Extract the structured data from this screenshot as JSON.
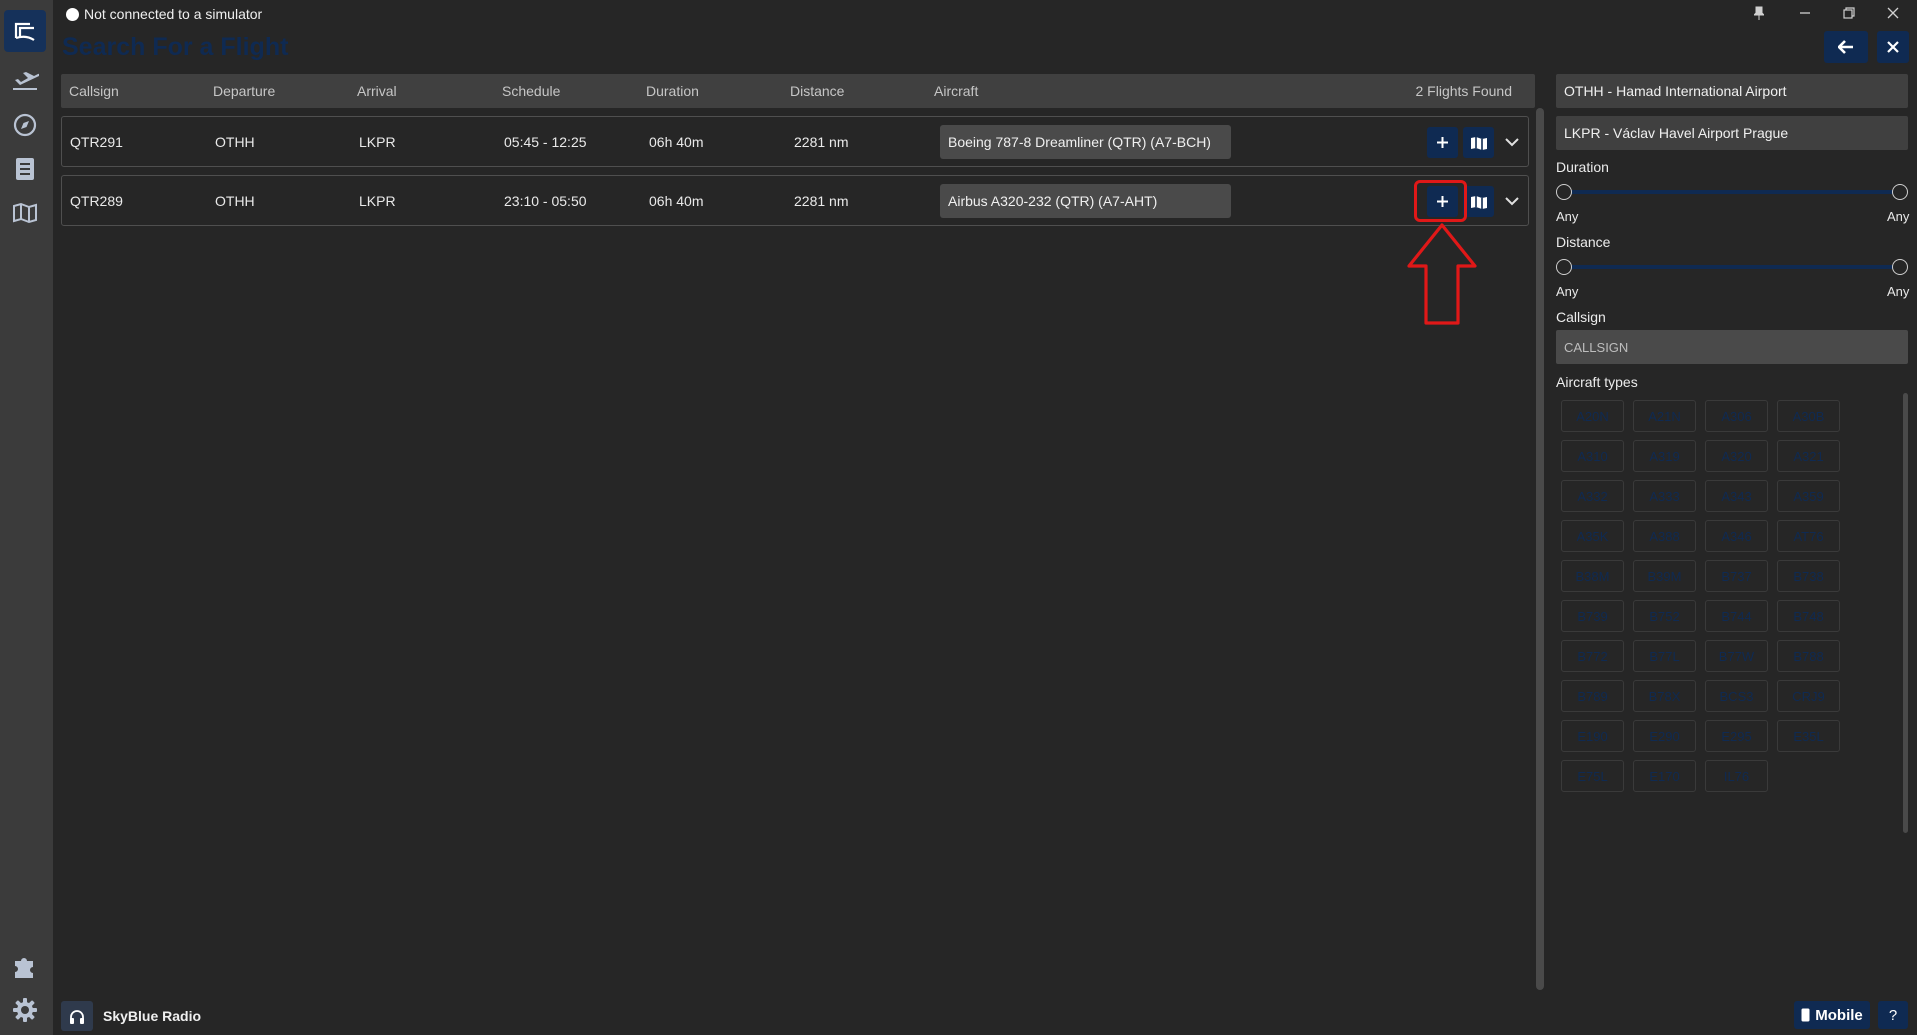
{
  "status": {
    "text": "Not connected to a simulator"
  },
  "page": {
    "title": "Search For a Flight"
  },
  "table": {
    "headers": [
      "Callsign",
      "Departure",
      "Arrival",
      "Schedule",
      "Duration",
      "Distance",
      "Aircraft"
    ],
    "found": "2 Flights Found",
    "rows": [
      {
        "callsign": "QTR291",
        "departure": "OTHH",
        "arrival": "LKPR",
        "schedule": "05:45 - 12:25",
        "duration": "06h 40m",
        "distance": "2281 nm",
        "aircraft": "Boeing 787-8 Dreamliner (QTR) (A7-BCH)"
      },
      {
        "callsign": "QTR289",
        "departure": "OTHH",
        "arrival": "LKPR",
        "schedule": "23:10 - 05:50",
        "duration": "06h 40m",
        "distance": "2281 nm",
        "aircraft": "Airbus A320-232 (QTR) (A7-AHT)"
      }
    ]
  },
  "filters": {
    "departure": "OTHH - Hamad International Airport",
    "arrival": "LKPR - Václav Havel Airport Prague",
    "duration_label": "Duration",
    "duration_min": "Any",
    "duration_max": "Any",
    "distance_label": "Distance",
    "distance_min": "Any",
    "distance_max": "Any",
    "callsign_label": "Callsign",
    "callsign_placeholder": "CALLSIGN",
    "aircraft_types_label": "Aircraft types",
    "aircraft_types": [
      "A20N",
      "A21N",
      "A306",
      "A30B",
      "A310",
      "A319",
      "A320",
      "A321",
      "A332",
      "A333",
      "A343",
      "A359",
      "A35K",
      "A388",
      "A346",
      "AT76",
      "B38M",
      "B39M",
      "B737",
      "B738",
      "B739",
      "B752",
      "B744",
      "B748",
      "B772",
      "B77L",
      "B77W",
      "B788",
      "B789",
      "B78X",
      "BCS3",
      "CRJ9",
      "E190",
      "E290",
      "E295",
      "E35L",
      "E75L",
      "E170",
      "IL76"
    ]
  },
  "footer": {
    "radio": "SkyBlue Radio",
    "mobile": "Mobile",
    "help": "?"
  },
  "colors": {
    "accent": "#0f2a52",
    "highlight": "#e01818",
    "background": "#262626",
    "rail": "#3b3b3b"
  },
  "icons": [
    "app-logo-icon",
    "flight-icon",
    "compass-icon",
    "logbook-icon",
    "map-icon",
    "puzzle-icon",
    "gear-icon",
    "headphones-icon",
    "mobile-icon",
    "plus-icon",
    "map-view-icon",
    "chevron-down-icon",
    "arrow-left-icon",
    "close-icon",
    "pin-icon",
    "minimize-icon",
    "restore-icon"
  ]
}
